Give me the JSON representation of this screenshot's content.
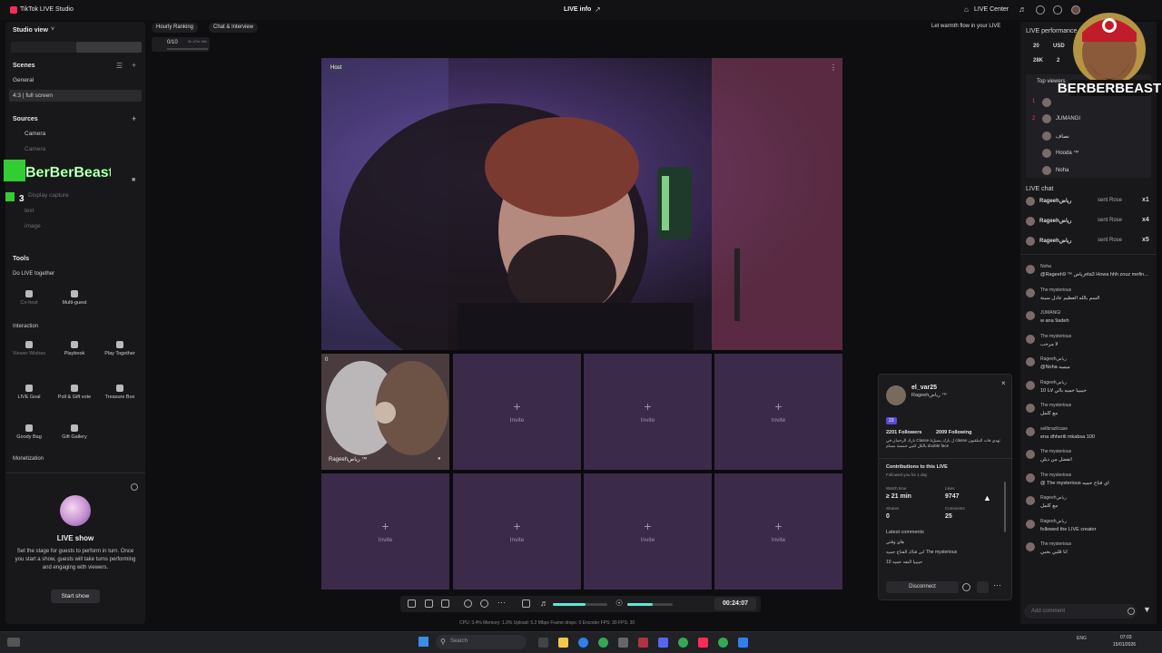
{
  "titlebar": {
    "app_title": "TikTok LIVE Studio",
    "center_title": "LIVE info",
    "live_center": "LIVE Center"
  },
  "left": {
    "studio_view": "Studio view",
    "scenes_title": "Scenes",
    "general": "General",
    "scene_item": "4:3 | full screen",
    "sources_title": "Sources",
    "sources": [
      "Camera",
      "Camera",
      "Display capture",
      "text",
      "image"
    ],
    "tools_title": "Tools",
    "go_live_together": "Do LIVE together",
    "tools_row1": [
      "Co-host",
      "Multi-guest"
    ],
    "interaction": "Interaction",
    "tools_row2": [
      "Viewer Wishes",
      "Playbook",
      "Play Together"
    ],
    "tools_row3": [
      "LIVE Goal",
      "Poll & Gift vote",
      "Treasure Box"
    ],
    "tools_row4": [
      "Goody Bag",
      "Gift Gallery"
    ],
    "monetization": "Monetization",
    "live_show_title": "LIVE show",
    "live_show_desc": "Set the stage for guests to perform in turn. Once you start a show, guests will take turns performing and engaging with viewers.",
    "start_show": "Start show"
  },
  "top_tags": {
    "hourly_ranking": "Hourly Ranking",
    "chat_interview": "Chat & Interview",
    "progress": "0/10",
    "timer": "3h 47m 46s",
    "warmth": "Let warmth flow in your LIVE"
  },
  "stage": {
    "host_badge": "Host",
    "guest_count": "0",
    "guest_name": "Rageehرياض ™",
    "invite": "Invite"
  },
  "profile_card": {
    "username": "el_var25",
    "subname": "Rageehرياض ™",
    "level": "23",
    "followers": "2201 Followers",
    "following": "2009 Following",
    "bio": "بارك الرحمان في Classe aل بارك يسبل classe تهدي فات الملقبون بالكل كتبي خمسة مسام double face",
    "contributions": "Contributions to this LIVE",
    "followed_for": "Followed you for 1 day",
    "watch_time_label": "Watch time",
    "watch_time": "≥ 21 min",
    "likes_label": "Likes",
    "likes": "9747",
    "shares_label": "Shares",
    "shares": "0",
    "comments_label": "Comments",
    "comments": "25",
    "latest_comments": "Latest comments",
    "latest": [
      "هاي وقتي",
      "اني فتاك الفتاح حميه The mysterious",
      "حيبييا البفه حميه 10"
    ],
    "disconnect": "Disconnect"
  },
  "right": {
    "perf_title": "LIVE performance",
    "stat1": "20",
    "stat2": "USD",
    "stat3": "28K",
    "stat4": "2",
    "top_viewers": "Top viewers",
    "top_list": [
      {
        "rank": "1",
        "name": ""
      },
      {
        "rank": "2",
        "name": "JUMANGI"
      },
      {
        "rank": "",
        "name": "نصاف"
      },
      {
        "rank": "",
        "name": "Hooda ™"
      },
      {
        "rank": "",
        "name": "Noha"
      }
    ],
    "live_chat": "LIVE chat",
    "gifts": [
      {
        "name": "Rageehرياض",
        "text": "sent Rose",
        "count": "x1"
      },
      {
        "name": "Rageehرياض",
        "text": "sent Rose",
        "count": "x4"
      },
      {
        "name": "Rageehرياض",
        "text": "sent Rose",
        "count": "x5"
      }
    ],
    "messages": [
      {
        "user": "Noha",
        "text": "@Rageehرياض ™ 9eta3 Howa hhh zouz mefinech"
      },
      {
        "user": "The mysterious",
        "text": "السم بالله العظيم عادل سينة"
      },
      {
        "user": "JUMANGI",
        "text": "w ana 9adeh"
      },
      {
        "user": "The mysterious",
        "text": "لا مرحب"
      },
      {
        "user": "Rageehرياض",
        "text": "@Noha ميميه"
      },
      {
        "user": "Rageehرياض",
        "text": "حيبيبا حميه بالي لانا 10"
      },
      {
        "user": "The mysterious",
        "text": "مع كلمل"
      },
      {
        "user": "sellbrazilcase",
        "text": "ena dhherili mkabsa 100"
      },
      {
        "user": "The mysterious",
        "text": "اتفضل من ديلن"
      },
      {
        "user": "The mysterious",
        "text": "@ The mysterious اي فتاح حميه"
      },
      {
        "user": "Rageehرياض",
        "text": "مع كلمل"
      },
      {
        "user": "Rageehرياض",
        "text": "followed the LIVE creator"
      },
      {
        "user": "The mysterious",
        "text": "انا قلبي بحبي"
      }
    ],
    "add_comment": "Add comment"
  },
  "toolbar": {
    "time": "00:24:07",
    "mic_level": 0.55,
    "volume_level": 0.6
  },
  "status": "CPU: 3.4%    Memory: 1.0%    Upload: 5.2 Mbps    Frame drops: 0    Encoder FPS: 30    FPS: 30",
  "taskbar": {
    "search": "Search",
    "time": "07:03",
    "date": "15/01/2026",
    "lang": "ENG"
  },
  "overlay": {
    "brand": "BERBERBEAST",
    "left_brand": "BerBerBeast",
    "left_num": "3"
  },
  "colors": {
    "accent": "#fe2c55",
    "invite_bg": "#3b2a4a",
    "host_bg": "#6b4f9a",
    "level_badge": "#5b4ad6"
  }
}
